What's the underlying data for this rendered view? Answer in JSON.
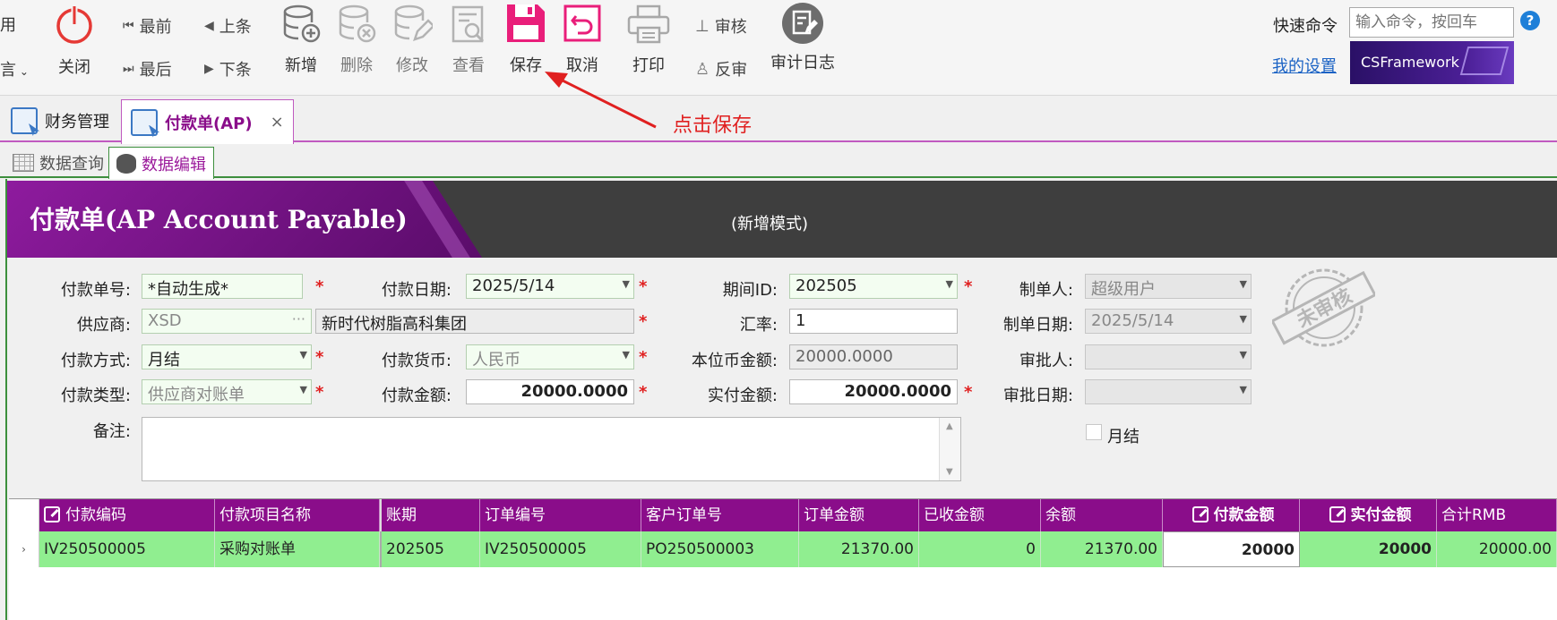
{
  "toolbar": {
    "left_cut_top": "用",
    "left_cut_bottom": "言",
    "close": "关闭",
    "first": "最前",
    "last": "最后",
    "prev": "上条",
    "next": "下条",
    "add": "新增",
    "delete": "删除",
    "edit": "修改",
    "view": "查看",
    "save": "保存",
    "cancel": "取消",
    "print": "打印",
    "approve": "审核",
    "unapprove": "反审",
    "audit_log": "审计日志",
    "quick_cmd_label": "快速命令",
    "quick_cmd_placeholder": "输入命令，按回车",
    "help": "?",
    "my_settings": "我的设置",
    "logo_text": "CSFramework"
  },
  "tabs": [
    {
      "label": "财务管理"
    },
    {
      "label": "付款单(AP)",
      "close": "×"
    }
  ],
  "subtabs": [
    {
      "label": "数据查询"
    },
    {
      "label": "数据编辑"
    }
  ],
  "annotation": "点击保存",
  "banner": {
    "title": "付款单(AP Account Payable)",
    "mode": "(新增模式)"
  },
  "form": {
    "pay_no_label": "付款单号:",
    "pay_no": "*自动生成*",
    "pay_date_label": "付款日期:",
    "pay_date": "2025/5/14",
    "period_label": "期间ID:",
    "period": "202505",
    "creator_label": "制单人:",
    "creator": "超级用户",
    "supplier_label": "供应商:",
    "supplier_code": "XSD",
    "supplier_name": "新时代树脂高科集团",
    "rate_label": "汇率:",
    "rate": "1",
    "create_date_label": "制单日期:",
    "create_date": "2025/5/14",
    "pay_method_label": "付款方式:",
    "pay_method": "月结",
    "currency_label": "付款货币:",
    "currency": "人民币",
    "local_amount_label": "本位币金额:",
    "local_amount": "20000.0000",
    "approver_label": "审批人:",
    "approver": "",
    "pay_type_label": "付款类型:",
    "pay_type": "供应商对账单",
    "pay_amount_label": "付款金额:",
    "pay_amount": "20000.0000",
    "actual_amount_label": "实付金额:",
    "actual_amount": "20000.0000",
    "approve_date_label": "审批日期:",
    "approve_date": "",
    "remark_label": "备注:",
    "remark": "",
    "monthly_label": "月结",
    "required_mark": "*",
    "stamp_text": "未审核"
  },
  "grid": {
    "columns": [
      "付款编码",
      "付款项目名称",
      "账期",
      "订单编号",
      "客户订单号",
      "订单金额",
      "已收金额",
      "余额",
      "付款金额",
      "实付金额",
      "合计RMB"
    ],
    "rows": [
      {
        "row_marker": "›",
        "code": "IV250500005",
        "item": "采购对账单",
        "period": "202505",
        "order_no": "IV250500005",
        "cust_order": "PO250500003",
        "order_amt": "21370.00",
        "received": "0",
        "balance": "21370.00",
        "pay_amt": "20000",
        "actual_amt": "20000",
        "total_rmb": "20000.00"
      }
    ]
  },
  "colors": {
    "accent": "#8a0d8a",
    "row_highlight": "#90ee90",
    "required": "#e02020"
  }
}
